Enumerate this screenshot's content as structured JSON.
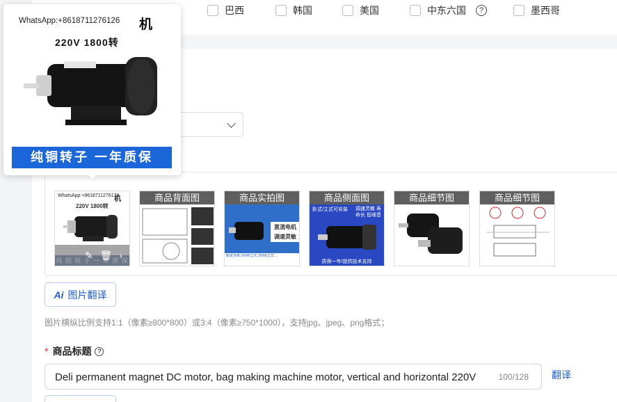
{
  "countries": [
    {
      "label": "巴西",
      "checked": false
    },
    {
      "label": "韩国",
      "checked": false
    },
    {
      "label": "美国",
      "checked": false
    },
    {
      "label": "中东六国",
      "checked": false,
      "help": "?"
    },
    {
      "label": "墨西哥",
      "checked": false
    }
  ],
  "preview": {
    "whatsapp": "WhatsApp:+8618711276126",
    "brand_fragment": "机",
    "spec": "220V  1800转",
    "banner": "纯铜转子  一年质保"
  },
  "thumbnails": [
    {
      "caption": "",
      "whatsapp": "WhatsApp:+8618711276126",
      "brand": "机",
      "spec": "220V  1800转",
      "footer": "纯 铜 转 子   一 年 质 保",
      "ops": {
        "edit": "✎",
        "delete": "🗑",
        "next": "›"
      }
    },
    {
      "caption": "商品背面图"
    },
    {
      "caption": "商品实拍图",
      "sign1": "直流电机",
      "sign2": "调速灵敏",
      "footer": "额定功率 200W立式 250W立式 ..."
    },
    {
      "caption": "商品侧面图",
      "tag1": "卧式/立式可安装",
      "tag2": "调速灵敏 寿命长 低噪音",
      "footer": "质保一年/提供技术支持"
    },
    {
      "caption": "商品细节图"
    },
    {
      "caption": "商品细节图"
    }
  ],
  "translate_button": {
    "icon": "Ai",
    "label": "图片翻译"
  },
  "hint": "图片横纵比例支持1:1（像素≥800*800）或3:4（像素≥750*1000），支持jpg、jpeg、png格式；",
  "title_field": {
    "required_mark": "*",
    "label": "商品标题",
    "help": "?",
    "value": "Deli permanent magnet DC motor, bag making machine motor, vertical and horizontal 220V",
    "counter": "100/128",
    "translate_link": "翻译"
  },
  "colors": {
    "accent": "#1f5fd6",
    "banner": "#1b66d9",
    "required": "#e23333"
  }
}
